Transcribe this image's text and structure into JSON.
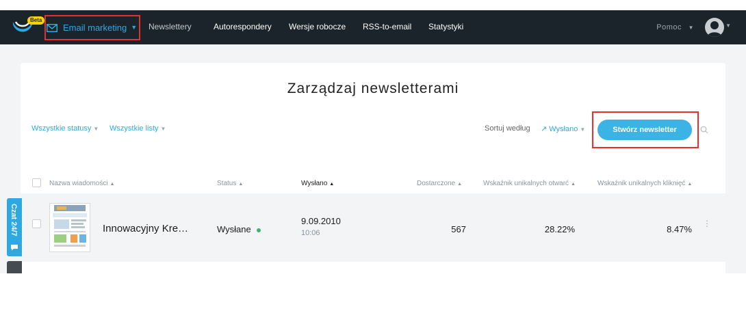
{
  "topbar": {
    "badge": "Beta",
    "primary_label": "Email marketing",
    "nav": [
      "Newslettery",
      "Autorespondery",
      "Wersje robocze",
      "RSS-to-email",
      "Statystyki"
    ],
    "help_label": "Pomoc"
  },
  "page": {
    "title": "Zarządzaj newsletterami",
    "filter_status": "Wszystkie statusy",
    "filter_lists": "Wszystkie listy",
    "sort_label": "Sortuj według",
    "sort_value": "↗ Wysłano",
    "create_label": "Stwórz newsletter"
  },
  "table": {
    "headers": {
      "name": "Nazwa wiadomości",
      "status": "Status",
      "sent": "Wysłano",
      "delivered": "Dostarczone",
      "open_rate": "Wskaźnik unikalnych otwarć",
      "click_rate": "Wskaźnik unikalnych kliknięć"
    },
    "rows": [
      {
        "name": "Innowacyjny Kre…",
        "status": "Wysłane",
        "date": "9.09.2010",
        "time": "10:06",
        "delivered": "567",
        "open_rate": "28.22%",
        "click_rate": "8.47%"
      }
    ]
  },
  "chat": {
    "label": "Czat 24/7"
  },
  "colors": {
    "accent": "#2fa8e0",
    "topbar": "#1b242a",
    "highlight": "#e5312b",
    "status_ok": "#3cb371"
  }
}
